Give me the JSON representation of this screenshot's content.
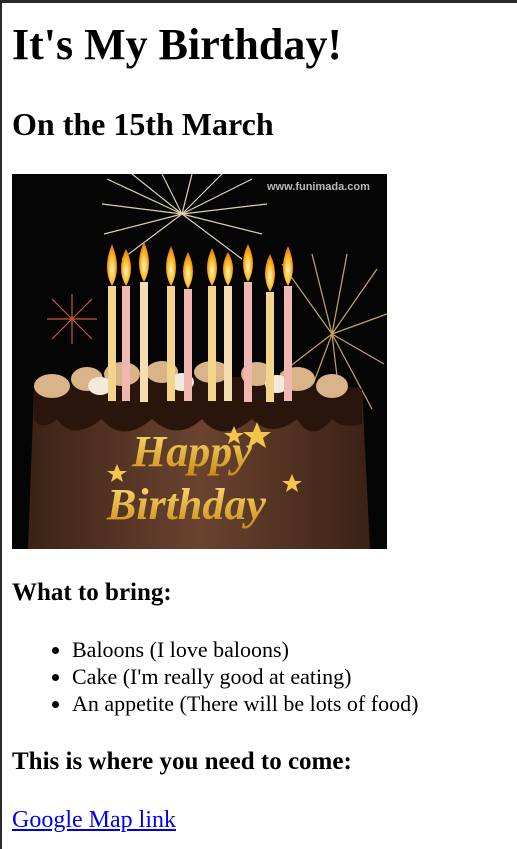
{
  "page": {
    "title": "It's My Birthday!",
    "date_heading": "On the 15th March"
  },
  "image": {
    "watermark": "www.funimada.com",
    "greeting_line1": "Happy",
    "greeting_line2": "Birthday",
    "icon": "birthday-cake-with-candles-and-fireworks"
  },
  "bring": {
    "heading": "What to bring:",
    "items": [
      "Baloons (I love baloons)",
      "Cake (I'm really good at eating)",
      "An appetite (There will be lots of food)"
    ]
  },
  "location": {
    "heading": "This is where you need to come:",
    "link_text": "Google Map link"
  },
  "colors": {
    "link": "#0000ee",
    "text": "#000000",
    "background": "#ffffff"
  }
}
